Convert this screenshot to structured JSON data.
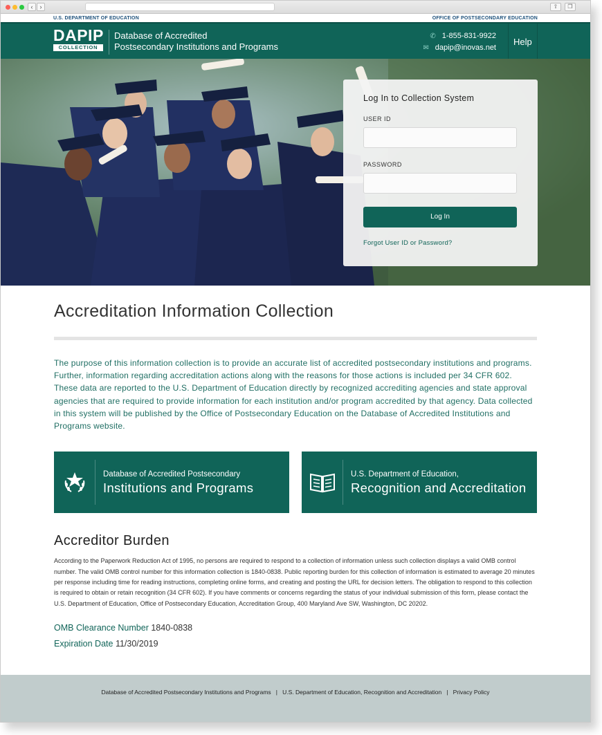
{
  "topbar": {
    "left": "U.S. DEPARTMENT OF EDUCATION",
    "right": "OFFICE OF POSTSECONDARY EDUCATION"
  },
  "header": {
    "logo_word": "DAPIP",
    "logo_sub": "COLLECTION",
    "title_line1": "Database of Accredited",
    "title_line2": "Postsecondary Institutions and Programs",
    "phone": "1-855-831-9922",
    "email": "dapip@inovas.net",
    "help": "Help"
  },
  "login": {
    "title": "Log In to Collection System",
    "user_label": "USER ID",
    "password_label": "PASSWORD",
    "button": "Log In",
    "forgot": "Forgot User ID or Password?"
  },
  "main": {
    "title": "Accreditation Information Collection",
    "intro": "The purpose of this information collection is to provide an accurate list of accredited postsecondary institutions and programs. Further, information regarding accreditation actions along with the reasons for those actions is included per 34 CFR 602. These data are reported to the U.S. Department of Education directly by recognized accrediting agencies and state approval agencies that are required to provide information for each institution and/or program accredited by that agency. Data collected in this system will be published by the Office of Postsecondary Education on the Database of Accredited Institutions and Programs website.",
    "cards": [
      {
        "small": "Database of Accredited Postsecondary",
        "big": "Institutions and Programs",
        "icon": "star-laurel-icon"
      },
      {
        "small": "U.S. Department of Education,",
        "big": "Recognition and Accreditation",
        "icon": "open-book-icon"
      }
    ],
    "burden_title": "Accreditor Burden",
    "burden_text": "According to the Paperwork Reduction Act of 1995, no persons are required to respond to a collection of information unless such collection displays a valid OMB control number. The valid OMB control number for this information collection is 1840-0838. Public reporting burden for this collection of information is estimated to average 20 minutes per response including time for reading instructions, completing online forms, and creating and posting the URL for decision letters. The obligation to respond to this collection is required to obtain or retain recognition (34 CFR 602). If you have comments or concerns regarding the status of your individual submission of this form, please contact the U.S. Department of Education, Office of Postsecondary Education, Accreditation Group, 400 Maryland Ave SW, Washington, DC 20202.",
    "omb_label": "OMB Clearance Number",
    "omb_value": "1840-0838",
    "exp_label": "Expiration Date",
    "exp_value": "11/30/2019"
  },
  "footer": {
    "link1": "Database of Accredited Postsecondary Institutions and Programs",
    "link2": "U.S. Department of Education, Recognition and Accreditation",
    "link3": "Privacy Policy",
    "sep": "|"
  },
  "colors": {
    "brand": "#106458",
    "footer": "#c1cccc"
  }
}
